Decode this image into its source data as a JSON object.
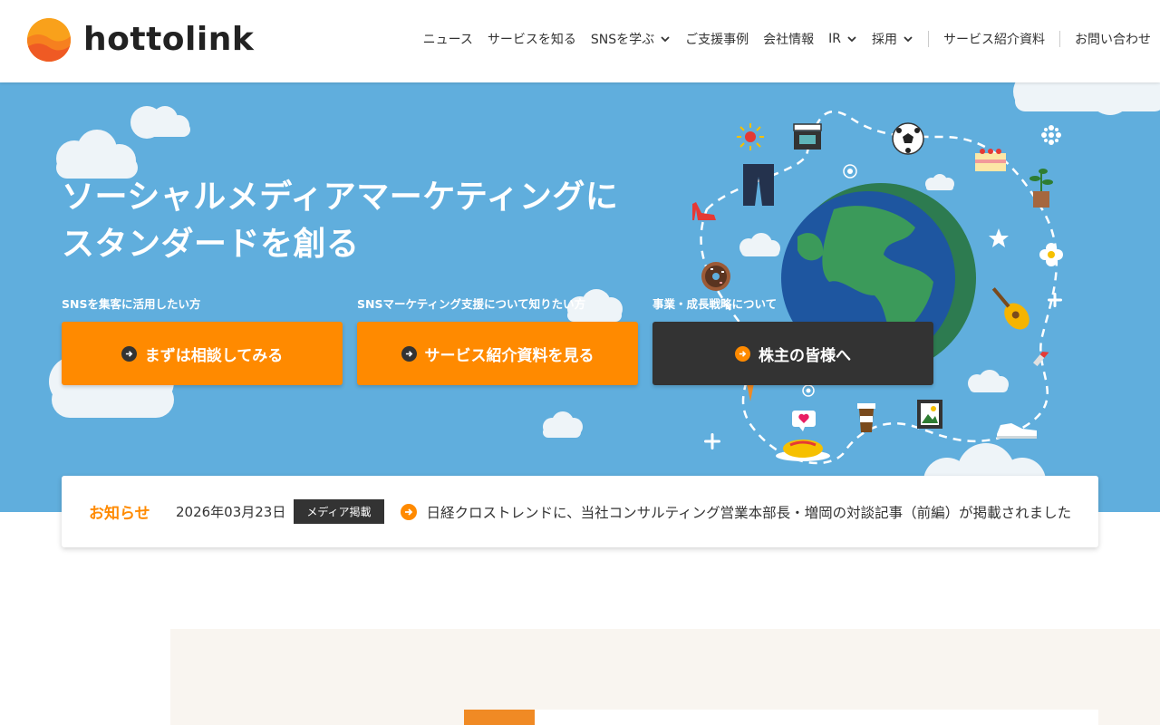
{
  "brand": {
    "name": "hottolink",
    "colors": {
      "accent": "#ff8a00",
      "hero_bg": "#60aedd",
      "dark": "#333333"
    }
  },
  "nav": {
    "items": [
      {
        "label": "ニュース",
        "dropdown": false
      },
      {
        "label": "サービスを知る",
        "dropdown": false
      },
      {
        "label": "SNSを学ぶ",
        "dropdown": true
      },
      {
        "label": "ご支援事例",
        "dropdown": false
      },
      {
        "label": "会社情報",
        "dropdown": false
      },
      {
        "label": "IR",
        "dropdown": true
      },
      {
        "label": "採用",
        "dropdown": true
      }
    ],
    "secondary": [
      {
        "label": "サービス紹介資料"
      },
      {
        "label": "お問い合わせ"
      }
    ]
  },
  "hero": {
    "title_line1": "ソーシャルメディアマーケティングに",
    "title_line2": "スタンダードを創る",
    "ctas": [
      {
        "caption": "SNSを集客に活用したい方",
        "label": "まずは相談してみる",
        "style": "orange"
      },
      {
        "caption": "SNSマーケティング支援について知りたい方",
        "label": "サービス紹介資料を見る",
        "style": "orange"
      },
      {
        "caption": "事業・成長戦略について",
        "label": "株主の皆様へ",
        "style": "dark"
      }
    ],
    "illustration_icons": [
      "sun-icon",
      "clapperboard-icon",
      "soccer-ball-icon",
      "cake-icon",
      "snowflake-icon",
      "jeans-icon",
      "high-heel-icon",
      "plant-icon",
      "star-icon",
      "flower-icon",
      "donut-icon",
      "guitar-icon",
      "globe-icon",
      "lipstick-icon",
      "coffee-cup-icon",
      "picture-frame-icon",
      "sneaker-icon",
      "omurice-icon",
      "heart-speech-bubble-icon"
    ]
  },
  "news": {
    "heading": "お知らせ",
    "date": "2026年03月23日",
    "category": "メディア掲載",
    "title": "日経クロストレンドに、当社コンサルティング営業本部長・増岡の対談記事（前編）が掲載されました"
  }
}
